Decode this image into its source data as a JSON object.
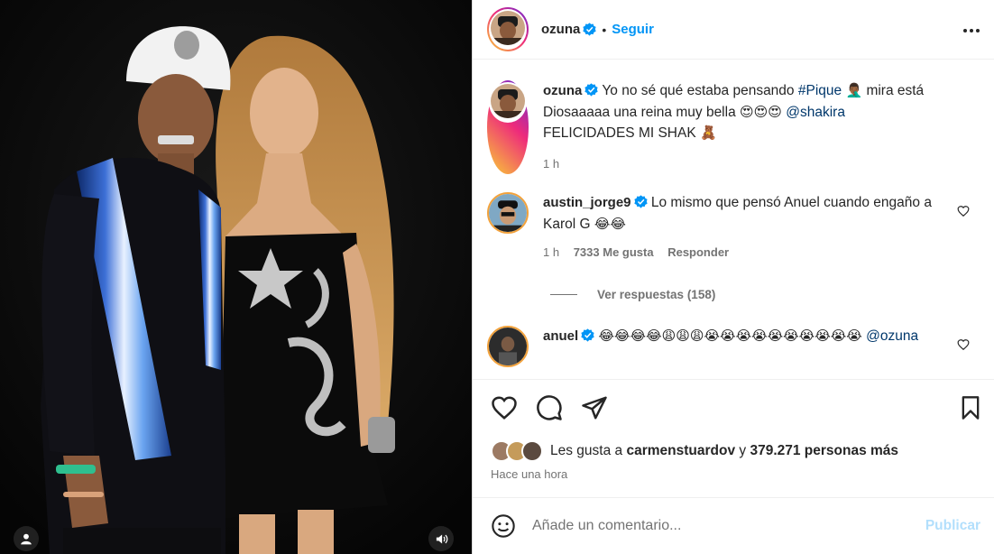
{
  "post": {
    "author": "ozuna",
    "follow_label": "Seguir",
    "dot": "•"
  },
  "caption": {
    "author": "ozuna",
    "text_1": "Yo no sé qué estaba pensando",
    "hashtag": "#Pique",
    "emoji_1": "🤦🏾‍♂️",
    "text_2": "mira está Diosaaaaa una reina muy bella",
    "emoji_2": "😍😍😍",
    "mention": "@shakira",
    "text_3": "FELICIDADES MI SHAK",
    "emoji_3": "🧸",
    "time": "1 h"
  },
  "comments": [
    {
      "author": "austin_jorge9",
      "text": "Lo mismo que pensó Anuel cuando engaño a Karol G",
      "emoji": "😂😂",
      "time": "1 h",
      "likes": "7333 Me gusta",
      "reply": "Responder"
    },
    {
      "author": "anuel",
      "emoji": "😂😂😂😂😩😩😩😭😭😭😭😭😭😭😭😭😭",
      "mention": "@ozuna"
    }
  ],
  "view_replies": "Ver respuestas (158)",
  "likes": {
    "prefix": "Les gusta a",
    "user": "carmenstuardov",
    "connector": "y",
    "rest": "379.271 personas más"
  },
  "posted_time": "Hace una hora",
  "add_comment": {
    "placeholder": "Añade un comentario...",
    "publish": "Publicar"
  },
  "colors": {
    "accent": "#0095f6",
    "link": "#00376b",
    "muted": "#737373",
    "publish_disabled": "#b2dffc"
  },
  "icons": [
    "verified-badge-icon",
    "more-options-icon",
    "heart-icon",
    "comment-icon",
    "share-icon",
    "bookmark-icon",
    "emoji-icon",
    "user-tag-icon",
    "sound-icon"
  ]
}
